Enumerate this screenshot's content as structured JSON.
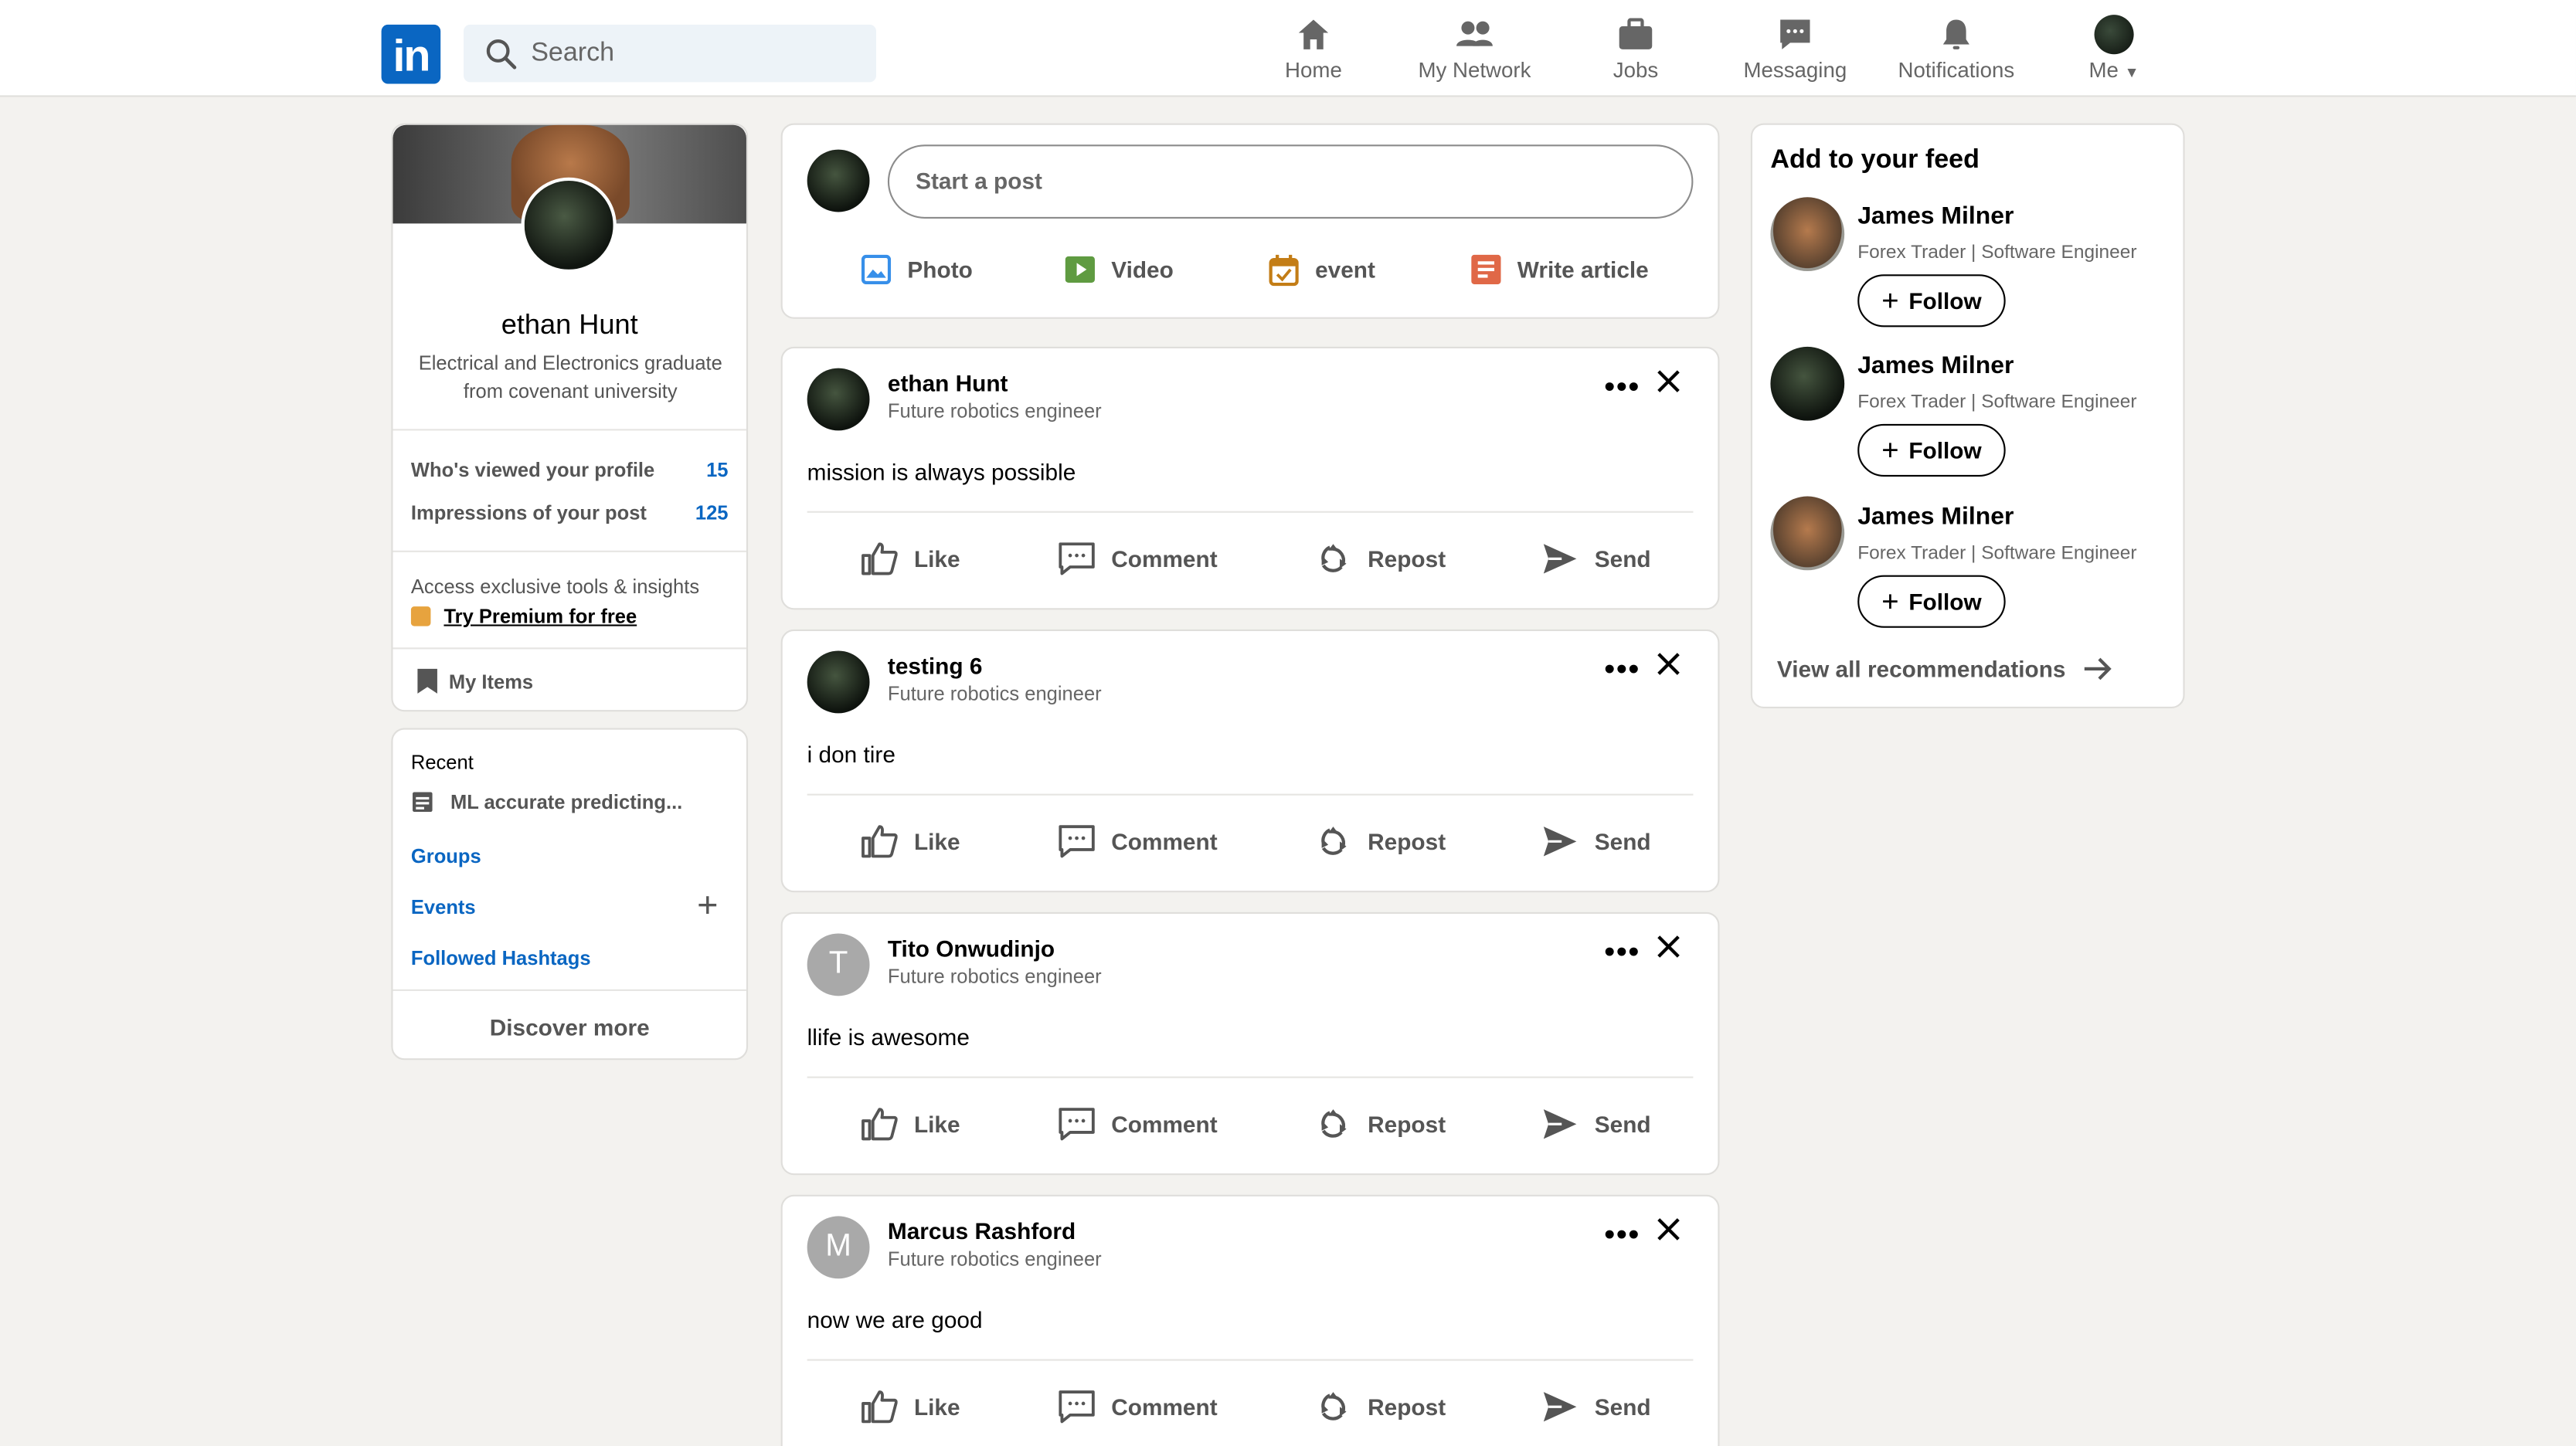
{
  "nav": {
    "logo": "in",
    "search_placeholder": "Search",
    "items": [
      {
        "label": "Home",
        "icon": "home-icon"
      },
      {
        "label": "My Network",
        "icon": "network-icon"
      },
      {
        "label": "Jobs",
        "icon": "jobs-icon"
      },
      {
        "label": "Messaging",
        "icon": "messaging-icon"
      },
      {
        "label": "Notifications",
        "icon": "bell-icon"
      },
      {
        "label": "Me",
        "icon": "avatar"
      }
    ]
  },
  "profile": {
    "name": "ethan Hunt",
    "headline": "Electrical and Electronics graduate from covenant university",
    "stats": [
      {
        "label": "Who's viewed your profile",
        "value": "15"
      },
      {
        "label": "Impressions of your post",
        "value": "125"
      }
    ],
    "premium_text": "Access exclusive tools & insights",
    "premium_link": "Try Premium for free",
    "my_items": "My Items"
  },
  "recent": {
    "label": "Recent",
    "item": "ML accurate predicting...",
    "groups": "Groups",
    "events": "Events",
    "hashtags": "Followed Hashtags",
    "discover": "Discover more"
  },
  "composer": {
    "placeholder": "Start a post",
    "actions": [
      {
        "label": "Photo",
        "color": "#378fe9"
      },
      {
        "label": "Video",
        "color": "#5f9b41"
      },
      {
        "label": "event",
        "color": "#c37d16"
      },
      {
        "label": "Write article",
        "color": "#e06847"
      }
    ]
  },
  "post_actions": [
    "Like",
    "Comment",
    "Repost",
    "Send"
  ],
  "posts": [
    {
      "name": "ethan Hunt",
      "subtitle": "Future robotics engineer",
      "text": "mission is always possible",
      "avatar": "photo"
    },
    {
      "name": "testing 6",
      "subtitle": "Future robotics engineer",
      "text": "i don tire",
      "avatar": "photo"
    },
    {
      "name": "Tito Onwudinjo",
      "subtitle": "Future robotics engineer",
      "text": "llife is awesome",
      "avatar": "T"
    },
    {
      "name": "Marcus Rashford",
      "subtitle": "Future robotics engineer",
      "text": "now we are good",
      "avatar": "M"
    }
  ],
  "feed": {
    "title": "Add to your feed",
    "people": [
      {
        "name": "James Milner",
        "headline": "Forex Trader | Software Engineer",
        "follow": "Follow"
      },
      {
        "name": "James Milner",
        "headline": "Forex Trader | Software Engineer",
        "follow": "Follow"
      },
      {
        "name": "James Milner",
        "headline": "Forex Trader | Software Engineer",
        "follow": "Follow"
      }
    ],
    "view_all": "View all recommendations"
  },
  "colors": {
    "brand": "#0a66c2",
    "background": "#f3f2ef",
    "premium": "#e7a33e"
  }
}
